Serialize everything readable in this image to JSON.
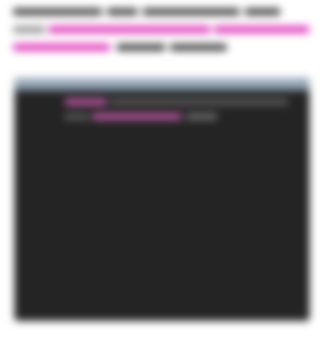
{
  "intro": {
    "line1": "",
    "line2": "",
    "line3": ""
  },
  "terminal": {
    "title": "",
    "lines": [
      "",
      "",
      ""
    ]
  },
  "colors": {
    "accent_pink": "#e13dbd",
    "terminal_bg": "#242424",
    "titlebar": "#8fa0b1"
  }
}
